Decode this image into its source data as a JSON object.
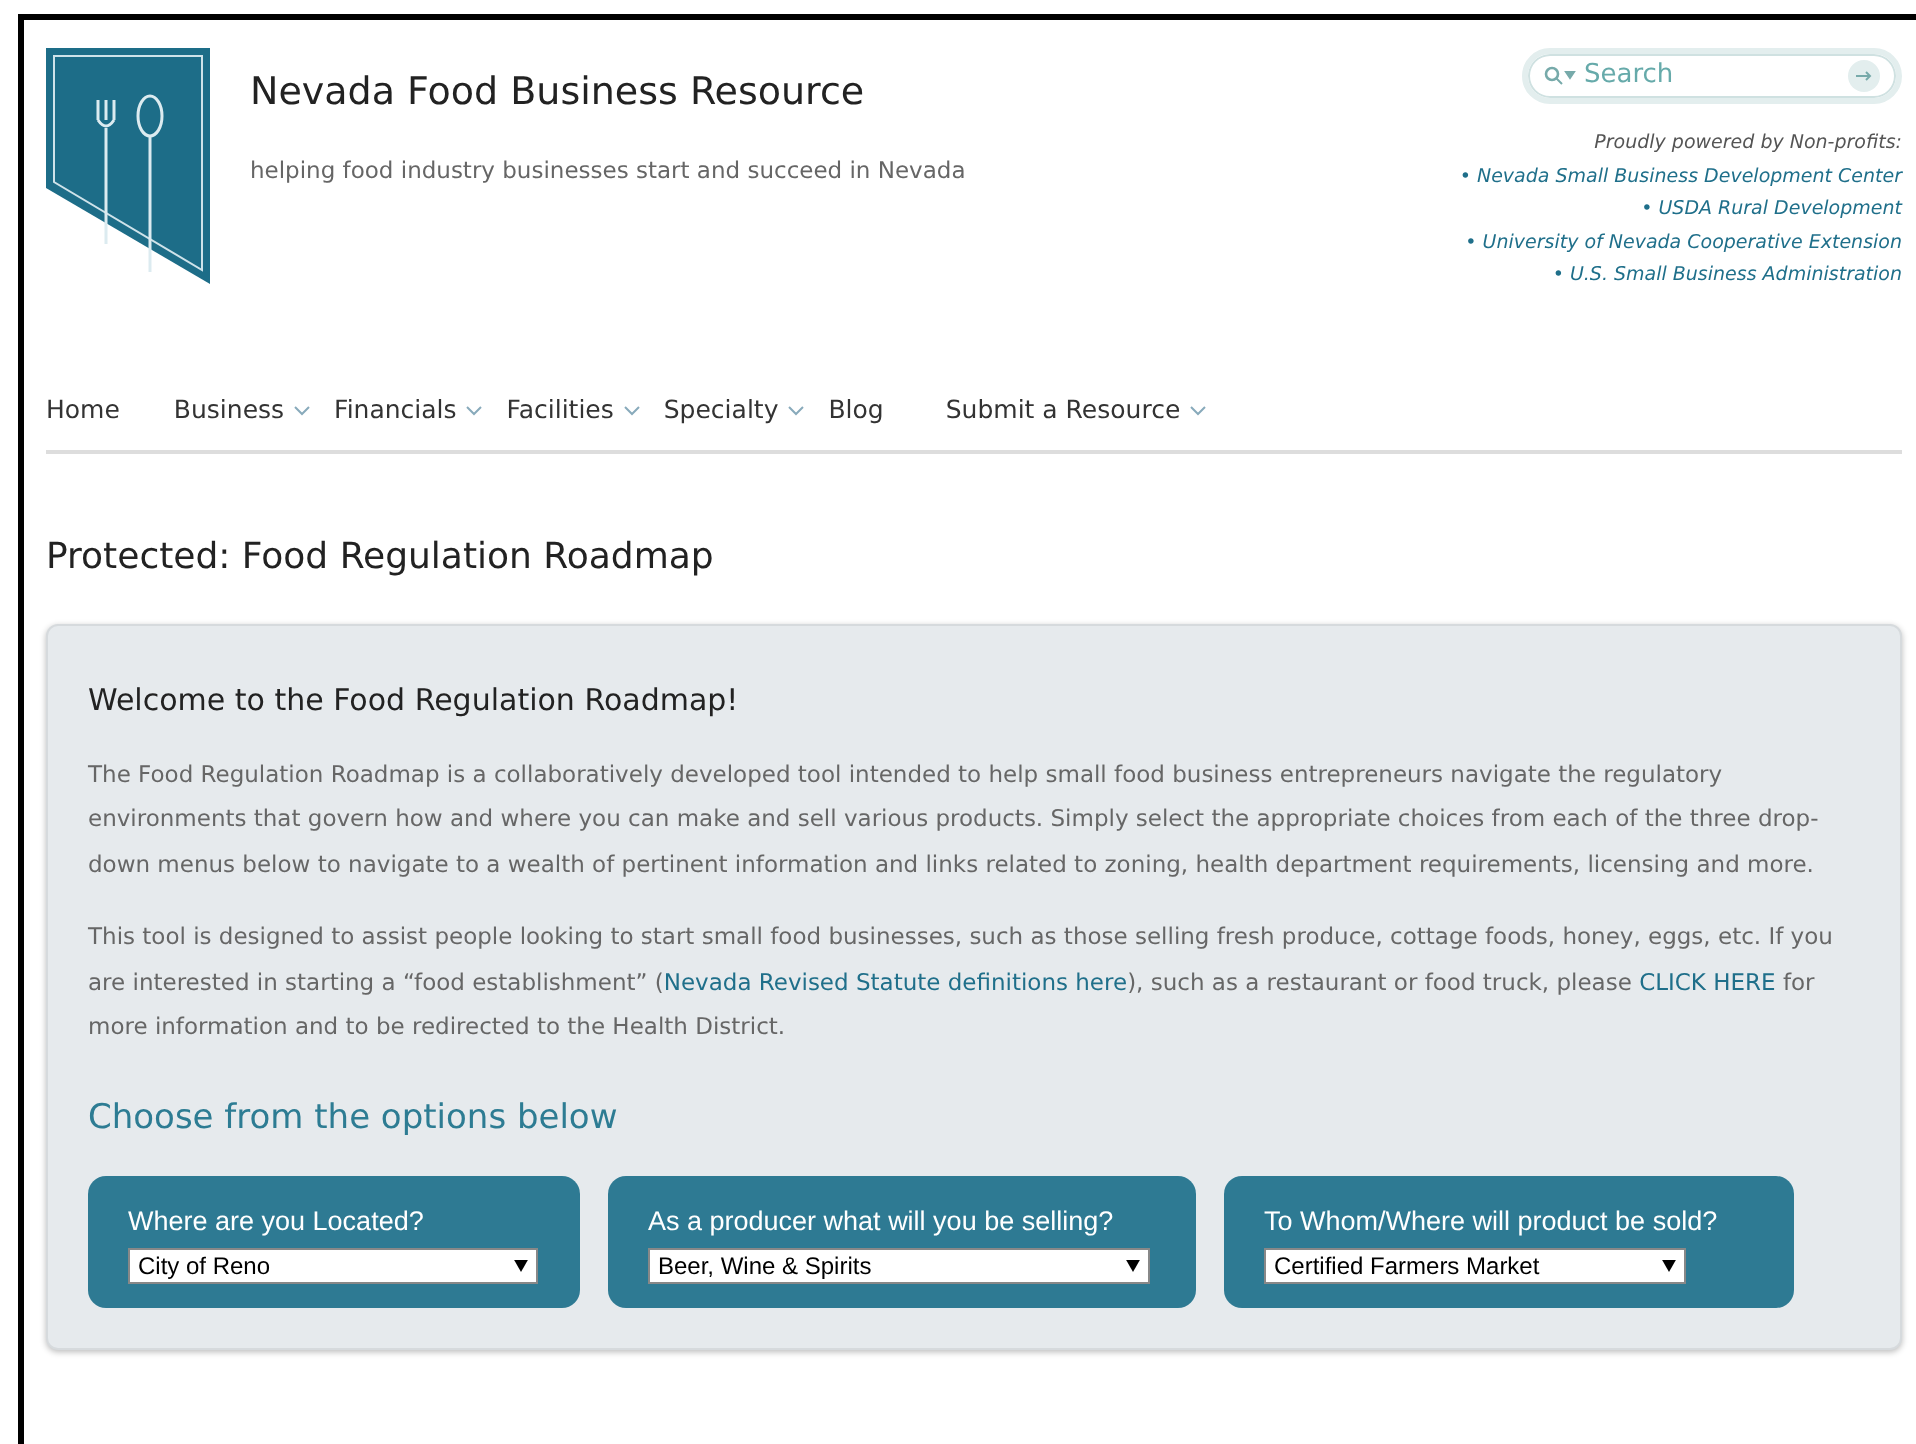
{
  "site": {
    "title": "Nevada Food Business Resource",
    "tagline": "helping food industry businesses start and succeed in Nevada"
  },
  "search": {
    "placeholder": "Search"
  },
  "sponsors": {
    "heading": "Proudly powered by Non-profits:",
    "items": [
      "• Nevada Small Business Development Center",
      "• USDA Rural Development",
      "• University of Nevada Cooperative Extension",
      "• U.S. Small Business Administration"
    ]
  },
  "nav": [
    {
      "label": "Home",
      "has_menu": false
    },
    {
      "label": "Business",
      "has_menu": true
    },
    {
      "label": "Financials",
      "has_menu": true
    },
    {
      "label": "Facilities",
      "has_menu": true
    },
    {
      "label": "Specialty",
      "has_menu": true
    },
    {
      "label": "Blog",
      "has_menu": false
    },
    {
      "label": "Submit a Resource",
      "has_menu": true
    }
  ],
  "page_title": "Protected: Food Regulation Roadmap",
  "panel": {
    "heading": "Welcome to the Food Regulation Roadmap!",
    "paragraphs": [
      [
        {
          "kind": "text",
          "text": "The Food Regulation Roadmap is a collaboratively developed tool intended to help small food business entrepreneurs navigate the regulatory environments that govern how and where you can make and sell various products. Simply select the appropriate choices from each of the three drop-down menus below to navigate to a wealth of pertinent information and links related to zoning, health department requirements, licensing and more."
        }
      ],
      [
        {
          "kind": "text",
          "text": "This tool is designed to assist people looking to start small food businesses, such as those selling fresh produce, cottage foods, honey, eggs, etc. If you are interested in starting a “food establishment” ("
        },
        {
          "kind": "link",
          "text": "Nevada Revised Statute definitions here"
        },
        {
          "kind": "text",
          "text": "), such as a restaurant or food truck, please "
        },
        {
          "kind": "link",
          "text": "CLICK HERE"
        },
        {
          "kind": "text",
          "text": " for more information and to be redirected to the Health District."
        }
      ]
    ],
    "options_heading": "Choose from the options below",
    "selectors": [
      {
        "label": "Where are you Located?",
        "value": "City of Reno"
      },
      {
        "label": "As a producer what will you be selling?",
        "value": "Beer, Wine & Spirits"
      },
      {
        "label": "To Whom/Where will product be sold?",
        "value": "Certified Farmers Market"
      }
    ]
  }
}
